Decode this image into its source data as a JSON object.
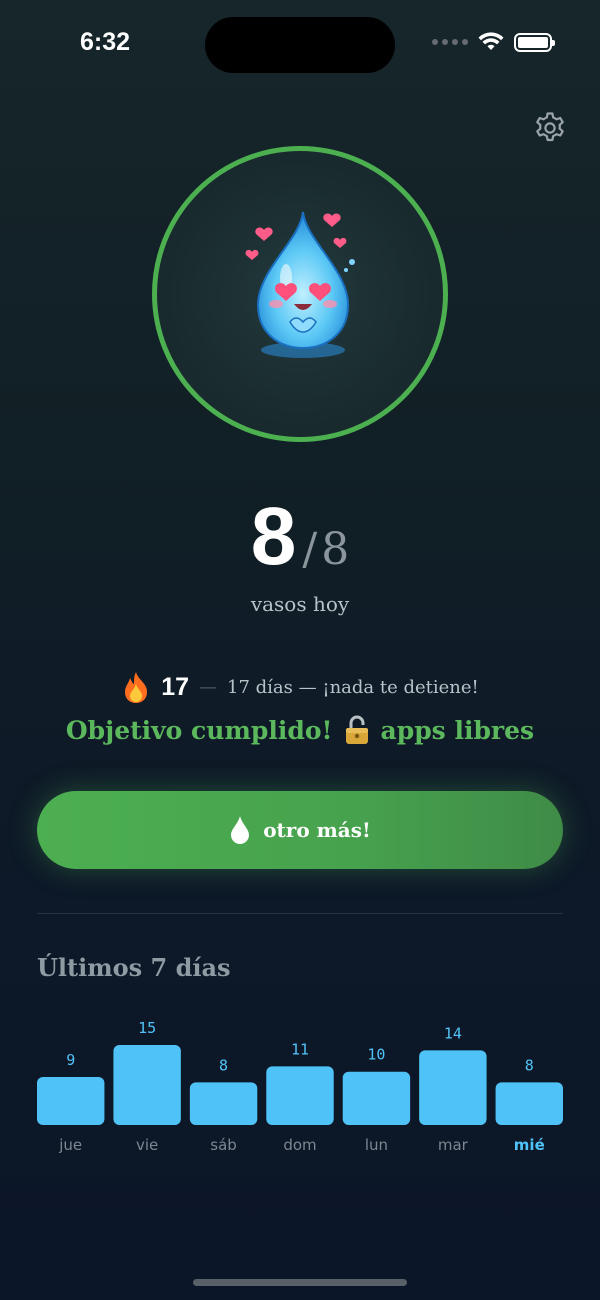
{
  "status_bar": {
    "time": "6:32"
  },
  "hydration": {
    "count": "8",
    "goal": "8",
    "separator": "/",
    "caption": "vasos hoy"
  },
  "streak": {
    "count": "17",
    "text": "17 días — ¡nada te detiene!"
  },
  "goal_status": {
    "text_before": "Objetivo cumplido!",
    "text_after": "apps libres"
  },
  "cta": {
    "label": "otro más!"
  },
  "history": {
    "title": "Últimos 7 días"
  },
  "chart_data": {
    "type": "bar",
    "categories": [
      "jue",
      "vie",
      "sáb",
      "dom",
      "lun",
      "mar",
      "mié"
    ],
    "values": [
      9,
      15,
      8,
      11,
      10,
      14,
      8
    ],
    "highlight_category": "mié",
    "bar_color": "#4fc3f7"
  },
  "colors": {
    "accent_green": "#4caf50",
    "accent_blue": "#4fc3f7",
    "background": "#0d1828"
  },
  "icons": {
    "settings": "gear-icon",
    "mascot": "water-drop-mascot",
    "streak": "fire-icon",
    "goal": "lock-icon",
    "cta": "water-drop-icon"
  }
}
